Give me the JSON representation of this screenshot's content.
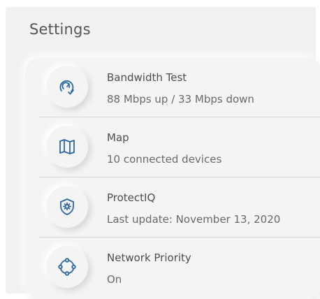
{
  "page": {
    "title": "Settings"
  },
  "accent_color": "#2b67a8",
  "items": [
    {
      "icon": "speedometer-icon",
      "label": "Bandwidth Test",
      "detail": "88 Mbps up / 33 Mbps down"
    },
    {
      "icon": "map-icon",
      "label": "Map",
      "detail": "10 connected devices"
    },
    {
      "icon": "shield-icon",
      "label": "ProtectIQ",
      "detail": "Last update: November 13, 2020"
    },
    {
      "icon": "network-priority-icon",
      "label": "Network Priority",
      "detail": "On"
    }
  ]
}
